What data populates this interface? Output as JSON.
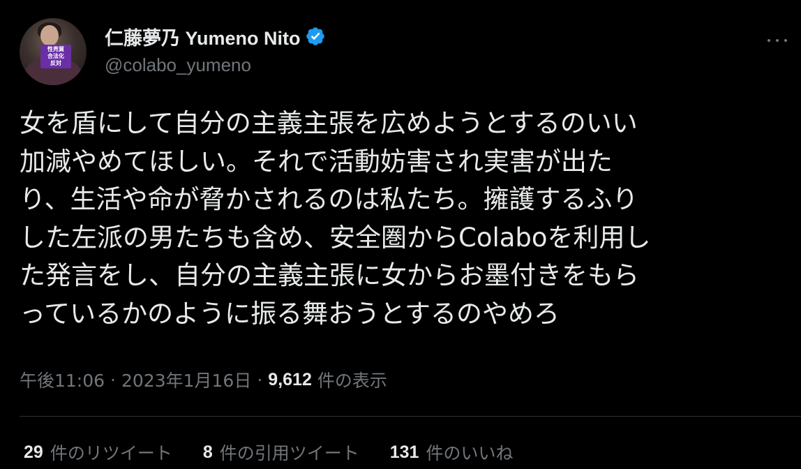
{
  "tweet": {
    "author": {
      "display_name": "仁藤夢乃 Yumeno Nito",
      "handle": "@colabo_yumeno",
      "verified": true,
      "verified_color": "#1d9bf0",
      "avatar_sign_text": "性売買\n合法化\n反対"
    },
    "text_lines": [
      "女を盾にして自分の主義主張を広めようとするのいい",
      "加減やめてほしい。それで活動妨害され実害が出た",
      "り、生活や命が脅かされるのは私たち。擁護するふり",
      "した左派の男たちも含め、安全圏からColaboを利用し",
      "た発言をし、自分の主義主張に女からお墨付きをもら",
      "っているかのように振る舞おうとするのやめろ"
    ],
    "meta": {
      "time": "午後11:06",
      "date": "2023年1月16日",
      "separator": "·",
      "views_count": "9,612",
      "views_label": "件の表示"
    },
    "stats": [
      {
        "count": "29",
        "label": "件のリツイート"
      },
      {
        "count": "8",
        "label": "件の引用ツイート"
      },
      {
        "count": "131",
        "label": "件のいいね"
      }
    ]
  },
  "icons": {
    "verified": "verified-badge-icon",
    "more": "more-horizontal-icon"
  },
  "colors": {
    "background": "#000000",
    "primary_text": "#e7e9ea",
    "secondary_text": "#71767b",
    "divider": "#2f3336"
  }
}
